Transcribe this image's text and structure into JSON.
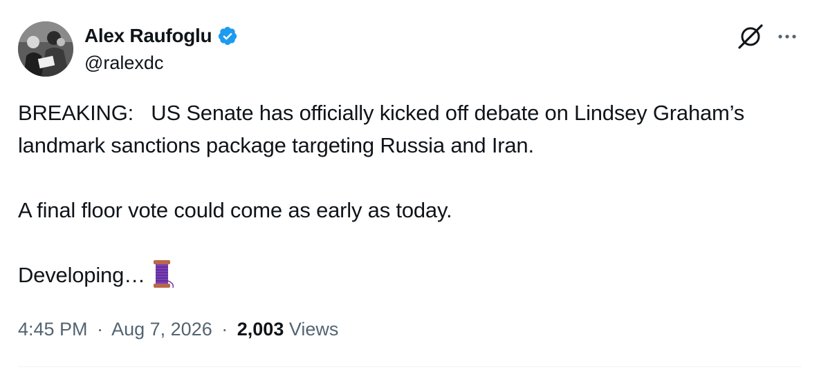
{
  "author": {
    "name": "Alex Raufoglu",
    "handle": "@ralexdc",
    "verified_color": "#1d9bf0",
    "avatar_icon": "avatar-photo"
  },
  "header_icons": {
    "grok": "grok-icon",
    "more": "more-icon"
  },
  "tweet": {
    "paragraphs": [
      "BREAKING:   US Senate has officially kicked off debate on Lindsey Graham’s landmark sanctions package targeting Russia and Iran.",
      "A final floor vote could come as early as today.",
      "Developing…"
    ],
    "trailing_emoji": "spool-of-thread-icon"
  },
  "meta": {
    "time": "4:45 PM",
    "separator": "·",
    "date": "Aug 7, 2026",
    "views_count": "2,003",
    "views_label": "Views"
  },
  "colors": {
    "text_primary": "#0f1419",
    "text_secondary": "#536471",
    "divider": "#eff3f4"
  }
}
